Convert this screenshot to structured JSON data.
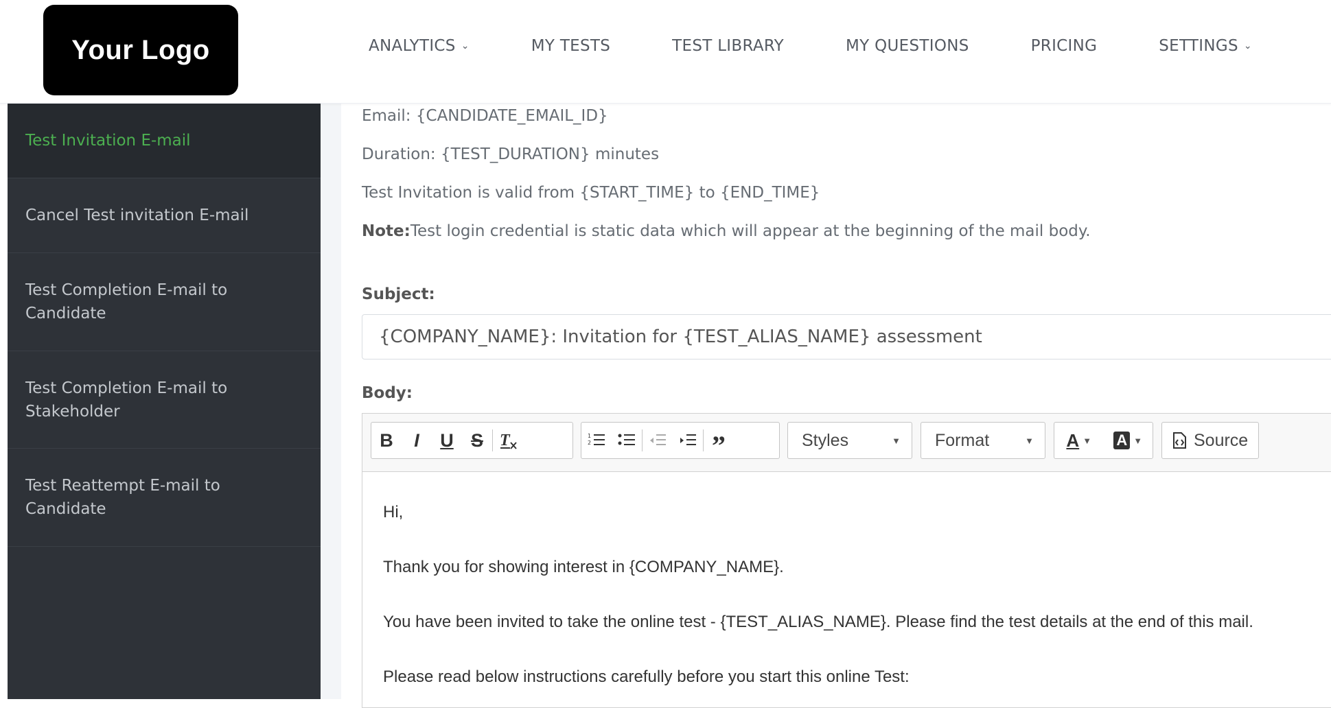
{
  "logo": "Your Logo",
  "nav": [
    {
      "label": "ANALYTICS",
      "dropdown": true
    },
    {
      "label": "MY TESTS",
      "dropdown": false
    },
    {
      "label": "TEST LIBRARY",
      "dropdown": false
    },
    {
      "label": "MY QUESTIONS",
      "dropdown": false
    },
    {
      "label": "PRICING",
      "dropdown": false
    },
    {
      "label": "SETTINGS",
      "dropdown": true
    }
  ],
  "sidebar": {
    "items": [
      {
        "label": "Test Invitation E-mail",
        "active": true
      },
      {
        "label": "Cancel Test invitation E-mail",
        "active": false
      },
      {
        "label": "Test Completion E-mail to Candidate",
        "active": false
      },
      {
        "label": "Test Completion E-mail to Stakeholder",
        "active": false
      },
      {
        "label": "Test Reattempt E-mail to Candidate",
        "active": false
      }
    ]
  },
  "main": {
    "info_lines": [
      "Email: {CANDIDATE_EMAIL_ID}",
      "Duration: {TEST_DURATION} minutes",
      "Test Invitation is valid from {START_TIME} to {END_TIME}"
    ],
    "note_label": "Note:",
    "note_text": "Test login credential is static data which will appear at the beginning of the mail body.",
    "subject_label": "Subject:",
    "subject_value": "{COMPANY_NAME}: Invitation for {TEST_ALIAS_NAME} assessment",
    "body_label": "Body:",
    "toolbar": {
      "bold": "B",
      "italic": "I",
      "underline": "U",
      "strike": "S",
      "remove_format": "Tx",
      "styles_label": "Styles",
      "format_label": "Format",
      "text_color": "A",
      "bg_color": "A",
      "source_label": "Source"
    },
    "body_lines": [
      "Hi,",
      "Thank you for showing interest in {COMPANY_NAME}.",
      "You have been invited to take the online test - {TEST_ALIAS_NAME}. Please find the test details at the end of this mail.",
      "Please read below instructions carefully before you start this online Test:"
    ]
  },
  "colors": {
    "active_green": "#4caf50",
    "sidebar_bg": "#2e3238",
    "logo_bg": "#000000"
  }
}
